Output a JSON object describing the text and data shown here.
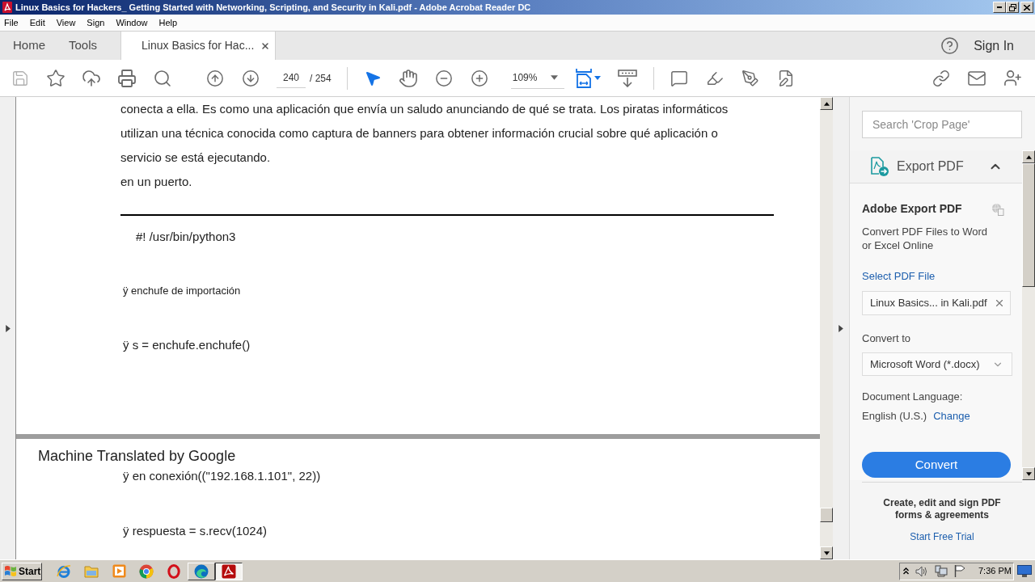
{
  "window": {
    "title": "Linux Basics for Hackers_ Getting Started with Networking, Scripting, and Security in Kali.pdf - Adobe Acrobat Reader DC"
  },
  "menu": [
    "File",
    "Edit",
    "View",
    "Sign",
    "Window",
    "Help"
  ],
  "tabs": [
    {
      "kind": "nav",
      "label": "Home",
      "selected": false
    },
    {
      "kind": "nav",
      "label": "Tools",
      "selected": false
    },
    {
      "kind": "document",
      "label": "Linux Basics for Hac...",
      "selected": true
    }
  ],
  "account": {
    "sign_in": "Sign In"
  },
  "toolbar": {
    "page": "240",
    "page_total": "/ 254",
    "zoom": "109%",
    "tools": [
      {
        "kind": "select",
        "selected": true
      },
      {
        "kind": "hand",
        "selected": false
      }
    ]
  },
  "document": {
    "pages": [
      {
        "blocks": [
          {
            "kind": "paragraph",
            "lines": [
              "conecta a ella. Es como una aplicación que envía un saludo anunciando de qué se trata. Los piratas informáticos",
              "utilizan una técnica conocida como captura de banners para obtener información crucial sobre qué aplicación o",
              "servicio se está ejecutando."
            ]
          },
          {
            "kind": "paragraph",
            "lines": [
              "en un puerto."
            ]
          },
          {
            "kind": "rule"
          },
          {
            "kind": "code_indented",
            "text": "#! /usr/bin/python3"
          },
          {
            "kind": "code_small",
            "text": "ÿ enchufe de importación"
          },
          {
            "kind": "code",
            "text": "ÿ s = enchufe.enchufe()"
          }
        ]
      },
      {
        "header": "Machine Translated by Google",
        "blocks": [
          {
            "kind": "code",
            "text": "ÿ en conexión((\"192.168.1.101\", 22))"
          },
          {
            "kind": "code",
            "text": "ÿ respuesta = s.recv(1024)"
          }
        ]
      }
    ]
  },
  "right_panel": {
    "search": {
      "placeholder": "Search 'Crop Page'"
    },
    "section": {
      "title": "Export PDF",
      "expanded": true
    },
    "heading": "Adobe Export PDF",
    "description": "Convert PDF Files to Word or Excel Online",
    "select_link": "Select PDF File",
    "file": {
      "value": "Linux Basics... in Kali.pdf"
    },
    "convert_label": "Convert to",
    "format": {
      "value": "Microsoft Word (*.docx)"
    },
    "language_label": "Document Language:",
    "language": "English (U.S.)",
    "change_link": "Change",
    "convert_button": "Convert",
    "promo": {
      "text": "Create, edit and sign PDF forms & agreements",
      "link": "Start Free Trial"
    }
  },
  "taskbar": {
    "start": "Start",
    "apps": [
      {
        "kind": "ie",
        "running": false,
        "selected": false
      },
      {
        "kind": "explorer",
        "running": false,
        "selected": false
      },
      {
        "kind": "media",
        "running": false,
        "selected": false
      },
      {
        "kind": "chrome",
        "running": false,
        "selected": false
      },
      {
        "kind": "opera",
        "running": false,
        "selected": false
      },
      {
        "kind": "edge",
        "running": true,
        "selected": false
      },
      {
        "kind": "acrobat",
        "running": true,
        "selected": true
      }
    ],
    "clock": "7:36 PM"
  }
}
